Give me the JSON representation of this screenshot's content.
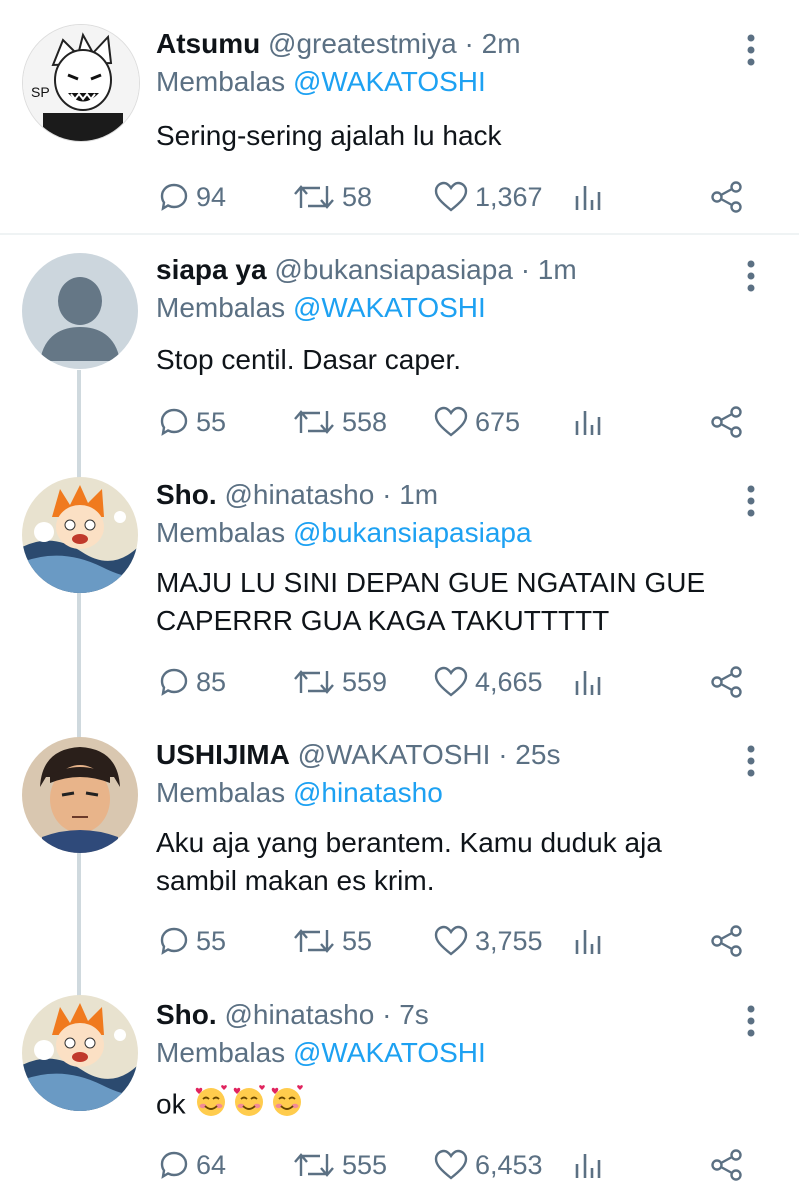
{
  "reply_prefix": "Membalas",
  "tweets": [
    {
      "name": "Atsumu",
      "handle": "@greatestmiya",
      "dot": "·",
      "time": "2m",
      "reply_to": "@WAKATOSHI",
      "text": "Sering-sering ajalah lu hack",
      "replies": "94",
      "retweets": "58",
      "likes": "1,367",
      "avatar": "manga-character-avatar"
    },
    {
      "name": "siapa ya",
      "handle": "@bukansiapasiapa",
      "dot": "·",
      "time": "1m",
      "reply_to": "@WAKATOSHI",
      "text": "Stop centil. Dasar caper.",
      "replies": "55",
      "retweets": "558",
      "likes": "675",
      "avatar": "default-avatar"
    },
    {
      "name": "Sho.",
      "handle": "@hinatasho",
      "dot": "·",
      "time": "1m",
      "reply_to": "@bukansiapasiapa",
      "text": "MAJU LU SINI DEPAN GUE NGATAIN GUE CAPERRR GUA KAGA TAKUTTTTT",
      "replies": "85",
      "retweets": "559",
      "likes": "4,665",
      "avatar": "orange-hair-anime-avatar"
    },
    {
      "name": "USHIJIMA",
      "handle": "@WAKATOSHI",
      "dot": "·",
      "time": "25s",
      "reply_to": "@hinatasho",
      "text": "Aku aja yang berantem. Kamu duduk aja sambil makan es krim.",
      "replies": "55",
      "retweets": "55",
      "likes": "3,755",
      "avatar": "dark-hair-anime-avatar"
    },
    {
      "name": "Sho.",
      "handle": "@hinatasho",
      "dot": "·",
      "time": "7s",
      "reply_to": "@WAKATOSHI",
      "text": "ok",
      "replies": "64",
      "retweets": "555",
      "likes": "6,453",
      "avatar": "orange-hair-anime-avatar",
      "emoji": "smiling-face-with-hearts x3"
    }
  ],
  "colors": {
    "mention": "#1da1f2",
    "muted": "#5b7083",
    "text": "#0f1419",
    "thread_line": "#cfd9de"
  }
}
